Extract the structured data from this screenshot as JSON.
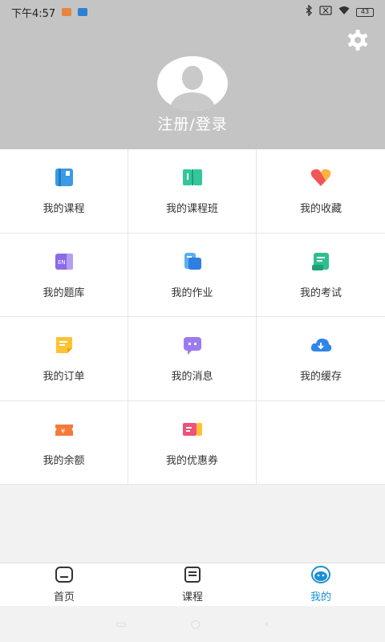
{
  "status_bar": {
    "time": "下午4:57",
    "battery": "43"
  },
  "header": {
    "login_label": "注册/登录"
  },
  "menu": [
    {
      "label": "我的课程",
      "icon": "course-book-icon"
    },
    {
      "label": "我的课程班",
      "icon": "class-book-icon"
    },
    {
      "label": "我的收藏",
      "icon": "heart-icon"
    },
    {
      "label": "我的题库",
      "icon": "question-bank-icon"
    },
    {
      "label": "我的作业",
      "icon": "homework-icon"
    },
    {
      "label": "我的考试",
      "icon": "exam-icon"
    },
    {
      "label": "我的订单",
      "icon": "order-icon"
    },
    {
      "label": "我的消息",
      "icon": "message-icon"
    },
    {
      "label": "我的缓存",
      "icon": "cloud-download-icon"
    },
    {
      "label": "我的余额",
      "icon": "balance-icon"
    },
    {
      "label": "我的优惠券",
      "icon": "coupon-icon"
    }
  ],
  "bottom_nav": [
    {
      "label": "首页"
    },
    {
      "label": "课程"
    },
    {
      "label": "我的"
    }
  ],
  "colors": {
    "accent": "#1b8fd2",
    "header_bg": "#c4c4c4"
  }
}
